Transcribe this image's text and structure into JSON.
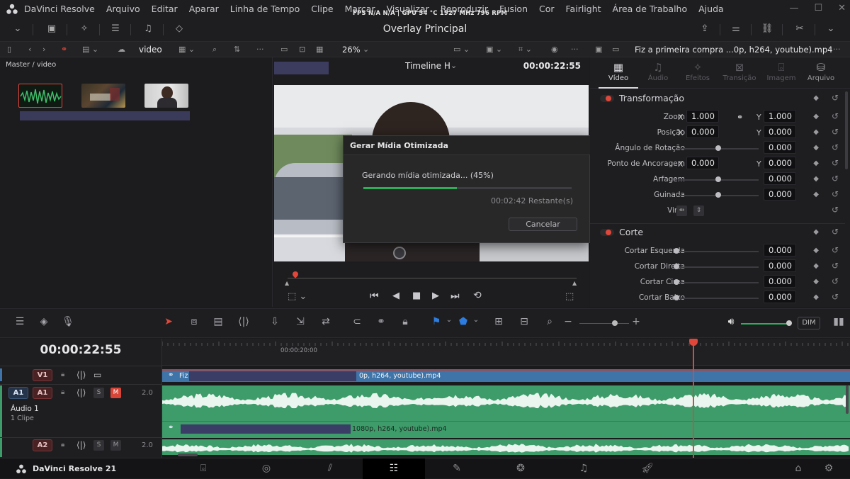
{
  "menubar": {
    "app_name": "DaVinci Resolve",
    "items": [
      "Arquivo",
      "Editar",
      "Aparar",
      "Linha de Tempo",
      "Clipe",
      "Marcar",
      "Visualizar",
      "Reproduzir",
      "Fusion",
      "Cor",
      "Fairlight",
      "Área de Trabalho",
      "Ajuda"
    ],
    "perf": "FPS  N/A  N/A  |  GPU 54 °C 1927 MHz 796 RPM"
  },
  "toolbar": {
    "title": "Overlay Principal"
  },
  "media_pool": {
    "bin_label": "video",
    "breadcrumb": "Master / video",
    "zoom": "26%"
  },
  "viewer": {
    "timeline_name": "Timeline H",
    "timecode": "00:00:22:55"
  },
  "dialog": {
    "title": "Gerar Mídia Otimizada",
    "message": "Gerando mídia otimizada... (45%)",
    "progress": 0.45,
    "remaining": "00:02:42 Restante(s)",
    "cancel_label": "Cancelar"
  },
  "inspector": {
    "clip_name": "Fiz a primeira compra ...0p, h264, youtube).mp4",
    "tabs": [
      {
        "label": "Vídeo",
        "icon": "film-icon"
      },
      {
        "label": "Áudio",
        "icon": "music-note-icon"
      },
      {
        "label": "Efeitos",
        "icon": "magic-wand-icon"
      },
      {
        "label": "Transição",
        "icon": "transition-icon"
      },
      {
        "label": "Imagem",
        "icon": "camera-icon"
      },
      {
        "label": "Arquivo",
        "icon": "drive-icon"
      }
    ],
    "transform": {
      "title": "Transformação",
      "zoom_label": "Zoom",
      "zoom_x": "1.000",
      "zoom_y": "1.000",
      "position_label": "Posição",
      "pos_x": "0.000",
      "pos_y": "0.000",
      "rotation_label": "Ângulo de Rotação",
      "rotation": "0.000",
      "anchor_label": "Ponto de Ancoragem",
      "anchor_x": "0.000",
      "anchor_y": "0.000",
      "pitch_label": "Arfagem",
      "pitch": "0.000",
      "yaw_label": "Guinada",
      "yaw": "0.000",
      "flip_label": "Virar",
      "x_axis": "X",
      "y_axis": "Y"
    },
    "crop": {
      "title": "Corte",
      "left_label": "Cortar Esquerda",
      "left": "0.000",
      "right_label": "Cortar Direita",
      "right": "0.000",
      "top_label": "Cortar Cima",
      "top": "0.000",
      "bottom_label": "Cortar Baixo",
      "bottom": "0.000"
    }
  },
  "edit_toolbar": {
    "dim_label": "DIM"
  },
  "timeline": {
    "timecode": "00:00:22:55",
    "ruler_mark": "00:00:20:00",
    "tracks": {
      "v1": "V1",
      "a1": "A1",
      "a1_target": "A1",
      "a1_channels": "2.0",
      "a1_name": "Áudio 1",
      "a1_clips": "1 Clipe",
      "a2": "A2",
      "a2_channels": "2.0",
      "s": "S",
      "m": "M"
    },
    "v1_clip_prefix": "Fiz",
    "v1_clip_suffix": "0p, h264, youtube).mp4",
    "a1_clip_suffix": "1080p, h264, youtube).mp4"
  },
  "footer": {
    "app_version": "DaVinci Resolve 21"
  },
  "colors": {
    "accent_red": "#e0473a",
    "audio_green": "#3e9b6a",
    "video_blue": "#3f74a8",
    "progress_green": "#2fae5a"
  }
}
